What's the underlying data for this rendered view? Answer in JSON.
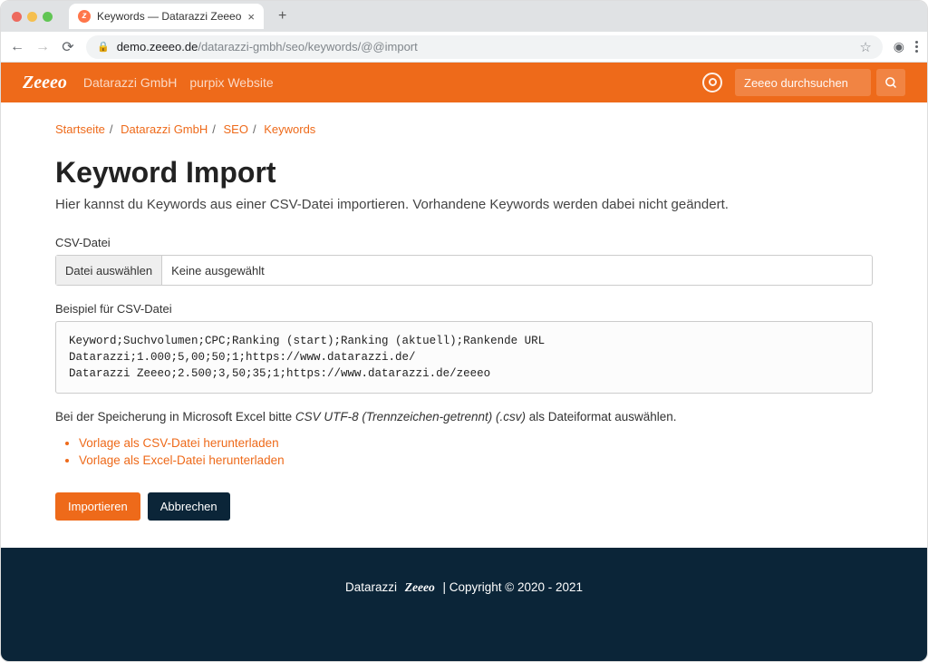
{
  "browser": {
    "tab_title": "Keywords — Datarazzi Zeeeo",
    "url_host": "demo.zeeeo.de",
    "url_path": "/datarazzi-gmbh/seo/keywords/@@import"
  },
  "header": {
    "logo": "Zeeeo",
    "nav": [
      "Datarazzi GmbH",
      "purpix Website"
    ],
    "search_placeholder": "Zeeeo durchsuchen"
  },
  "breadcrumb": [
    "Startseite",
    "Datarazzi GmbH",
    "SEO",
    "Keywords"
  ],
  "page": {
    "title": "Keyword Import",
    "lead": "Hier kannst du Keywords aus einer CSV-Datei importieren. Vorhandene Keywords werden dabei nicht geändert.",
    "csv_label": "CSV-Datei",
    "file_button": "Datei auswählen",
    "file_status": "Keine ausgewählt",
    "example_label": "Beispiel für CSV-Datei",
    "example_text": "Keyword;Suchvolumen;CPC;Ranking (start);Ranking (aktuell);Rankende URL\nDatarazzi;1.000;5,00;50;1;https://www.datarazzi.de/\nDatarazzi Zeeeo;2.500;3,50;35;1;https://www.datarazzi.de/zeeeo",
    "note_prefix": "Bei der Speicherung in Microsoft Excel bitte ",
    "note_em": "CSV UTF-8 (Trennzeichen-getrennt) (.csv)",
    "note_suffix": " als Dateiformat auswählen.",
    "link_csv": "Vorlage als CSV-Datei herunterladen",
    "link_excel": "Vorlage als Excel-Datei herunterladen",
    "btn_import": "Importieren",
    "btn_cancel": "Abbrechen"
  },
  "footer": {
    "company": "Datarazzi",
    "logo": "Zeeeo",
    "copyright": "| Copyright © 2020 - 2021"
  }
}
